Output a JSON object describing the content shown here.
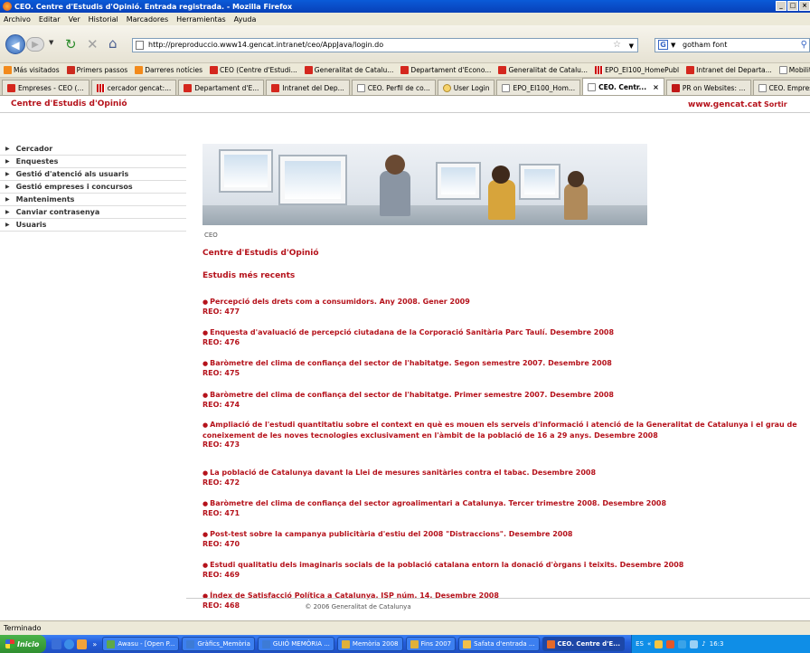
{
  "window": {
    "title": "CEO. Centre d'Estudis d'Opinió. Entrada registrada. - Mozilla Firefox"
  },
  "menu": [
    "Archivo",
    "Editar",
    "Ver",
    "Historial",
    "Marcadores",
    "Herramientas",
    "Ayuda"
  ],
  "nav": {
    "url": "http://preproduccio.www14.gencat.intranet/ceo/AppJava/login.do",
    "search_value": "gotham font"
  },
  "bookmarks": [
    {
      "label": "Más visitados",
      "icon": "rss-icon"
    },
    {
      "label": "Primers passos",
      "icon": "red-icon"
    },
    {
      "label": "Darreres notícies",
      "icon": "rss-icon"
    },
    {
      "label": "CEO (Centre d'Estudi...",
      "icon": "gencat-icon"
    },
    {
      "label": "Generalitat de Catalu...",
      "icon": "gencat-icon"
    },
    {
      "label": "Departament d'Econo...",
      "icon": "gencat-icon"
    },
    {
      "label": "Generalitat de Catalu...",
      "icon": "gencat-icon"
    },
    {
      "label": "EPO_EI100_HomePubl",
      "icon": "bars-icon"
    },
    {
      "label": "Intranet del Departa...",
      "icon": "gencat-icon"
    },
    {
      "label": "Mobilitat",
      "icon": "page-icon"
    }
  ],
  "bookmarks_more": "»",
  "tabs": [
    {
      "label": "Empreses - CEO (...",
      "icon": "gencat-icon",
      "active": false
    },
    {
      "label": "cercador gencat:...",
      "icon": "bars-icon",
      "active": false
    },
    {
      "label": "Departament d'E...",
      "icon": "gencat-icon",
      "active": false
    },
    {
      "label": "Intranet del Dep...",
      "icon": "gencat-icon",
      "active": false
    },
    {
      "label": "CEO. Perfil de co...",
      "icon": "page-icon",
      "active": false
    },
    {
      "label": "User Login",
      "icon": "user-icon",
      "active": false
    },
    {
      "label": "EPO_EI100_Hom...",
      "icon": "page-icon",
      "active": false
    },
    {
      "label": "CEO. Centr...",
      "icon": "page-icon",
      "active": true
    },
    {
      "label": "PR on Websites: ...",
      "icon": "pr-icon",
      "active": false
    },
    {
      "label": "CEO. Empreses H...",
      "icon": "page-icon",
      "active": false
    }
  ],
  "page": {
    "site_title": "Centre d'Estudis d'Opinió",
    "gencat_link": "www.gencat.cat",
    "sortir": "Sortir",
    "sidebar": [
      "Cercador",
      "Enquestes",
      "Gestió d'atenció als usuaris",
      "Gestió empreses i concursos",
      "Manteniments",
      "Canviar contrasenya",
      "Usuaris"
    ],
    "breadcrumb": "CEO",
    "centre_title": "Centre d'Estudis d'Opinió",
    "section_title": "Estudis més recents",
    "studies": [
      {
        "title": "Percepció dels drets com a consumidors. Any 2008. Gener 2009",
        "reo": "REO: 477"
      },
      {
        "title": "Enquesta d'avaluació de percepció ciutadana de la Corporació Sanitària Parc Taulí. Desembre 2008",
        "reo": "REO: 476"
      },
      {
        "title": "Baròmetre del clima de confiança del sector de l'habitatge. Segon semestre 2007. Desembre 2008",
        "reo": "REO: 475"
      },
      {
        "title": "Baròmetre del clima de confiança del sector de l'habitatge. Primer semestre 2007. Desembre 2008",
        "reo": "REO: 474"
      },
      {
        "title": "Ampliació de l'estudi quantitatiu sobre el context en què es mouen els serveis d'informació i atenció de la Generalitat de Catalunya i el grau de coneixement de les noves tecnologies exclusivament en l'àmbit de la població de 16 a 29 anys. Desembre 2008",
        "reo": "REO: 473"
      },
      {
        "title": "La població de Catalunya davant la Llei de mesures sanitàries contra el tabac. Desembre 2008",
        "reo": "REO: 472"
      },
      {
        "title": "Baròmetre del clima de confiança del sector agroalimentari a Catalunya. Tercer trimestre 2008. Desembre 2008",
        "reo": "REO: 471"
      },
      {
        "title": "Post-test sobre la campanya publicitària d'estiu del 2008 \"Distraccions\". Desembre 2008",
        "reo": "REO: 470"
      },
      {
        "title": "Estudi qualitatiu dels imaginaris socials de la població catalana entorn la donació d'òrgans i teixits. Desembre 2008",
        "reo": "REO: 469"
      },
      {
        "title": "Índex de Satisfacció Política a Catalunya. ISP núm. 14. Desembre 2008",
        "reo": "REO: 468"
      }
    ],
    "footer": "© 2006 Generalitat de Catalunya"
  },
  "status": "Terminado",
  "taskbar": {
    "start": "Inicio",
    "chevron": "»",
    "tasks": [
      {
        "label": "Awasu - [Open P...",
        "active": false
      },
      {
        "label": "Gràfics_Memòria",
        "active": false
      },
      {
        "label": "GUIÓ MEMÒRIA ...",
        "active": false
      },
      {
        "label": "Memòria 2008",
        "active": false
      },
      {
        "label": "Fins 2007",
        "active": false
      },
      {
        "label": "Safata d'entrada ...",
        "active": false
      },
      {
        "label": "CEO. Centre d'E...",
        "active": true
      }
    ],
    "lang": "ES",
    "tray_chevron": "«",
    "clock": "16:3"
  }
}
